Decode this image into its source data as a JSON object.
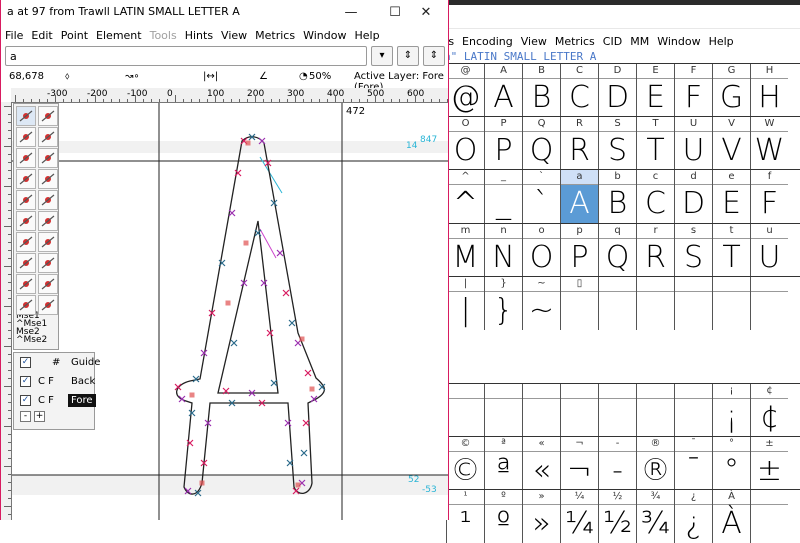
{
  "font_window": {
    "menu": [
      "ts",
      "Encoding",
      "View",
      "Metrics",
      "CID",
      "MM",
      "Window",
      "Help"
    ],
    "glyph_name": "a\" LATIN SMALL LETTER A",
    "rows": [
      {
        "labels": [
          "@",
          "A",
          "B",
          "C",
          "D",
          "E",
          "F",
          "G",
          "H"
        ],
        "glyphs": [
          "@",
          "A",
          "B",
          "C",
          "D",
          "E",
          "F",
          "G",
          "H"
        ]
      },
      {
        "labels": [
          "O",
          "P",
          "Q",
          "R",
          "S",
          "T",
          "U",
          "V",
          "W"
        ],
        "glyphs": [
          "O",
          "P",
          "Q",
          "R",
          "S",
          "T",
          "U",
          "V",
          "W"
        ]
      },
      {
        "labels": [
          "^",
          "_",
          "`",
          "a",
          "b",
          "c",
          "d",
          "e",
          "f"
        ],
        "glyphs": [
          "^",
          "_",
          "`",
          "A",
          "B",
          "C",
          "D",
          "E",
          "F"
        ]
      },
      {
        "labels": [
          "m",
          "n",
          "o",
          "p",
          "q",
          "r",
          "s",
          "t",
          "u"
        ],
        "glyphs": [
          "M",
          "N",
          "O",
          "P",
          "Q",
          "R",
          "S",
          "T",
          "U"
        ]
      },
      {
        "labels": [
          "|",
          "}",
          "~",
          "▯",
          "",
          "",
          "",
          "",
          ""
        ],
        "glyphs": [
          "|",
          "}",
          "~",
          "",
          "",
          "",
          "",
          "",
          ""
        ]
      },
      {
        "labels": [
          "",
          "",
          "",
          "",
          "",
          "",
          "",
          "¡",
          "¢"
        ],
        "glyphs": [
          "",
          "",
          "",
          "",
          "",
          "",
          "",
          "¡",
          "¢"
        ]
      },
      {
        "labels": [
          "©",
          "ª",
          "«",
          "¬",
          "-",
          "®",
          "¯",
          "°",
          "±"
        ],
        "glyphs": [
          "©",
          "ª",
          "«",
          "¬",
          "-",
          "®",
          "¯",
          "°",
          "±"
        ]
      },
      {
        "labels": [
          "¹",
          "º",
          "»",
          "¼",
          "½",
          "¾",
          "¿",
          "À",
          ""
        ],
        "glyphs": [
          "¹",
          "º",
          "»",
          "¼",
          "½",
          "¾",
          "¿",
          "À",
          ""
        ]
      }
    ],
    "selected_label": "a"
  },
  "glyph_window": {
    "title": "a at 97 from Trawll LATIN SMALL LETTER A",
    "window_buttons": {
      "minimize": "—",
      "maximize": "☐",
      "close": "✕"
    },
    "menu": [
      "File",
      "Edit",
      "Point",
      "Element",
      "Tools",
      "Hints",
      "View",
      "Metrics",
      "Window",
      "Help"
    ],
    "disabled_menu": "Tools",
    "input_value": "a",
    "buttons": {
      "dropdown": "▾",
      "prev": "⇕",
      "next": "⇕"
    },
    "status": {
      "coords": "68,678",
      "point_symbol": "⬨",
      "zoom": "50%",
      "active_layer": "Active Layer: Fore (Fore)"
    },
    "ruler_labels": [
      "-300",
      "-200",
      "-100",
      "0",
      "100",
      "200",
      "300",
      "400",
      "500",
      "600"
    ],
    "canvas_labels": {
      "advance": "472",
      "ascent": "847",
      "ascent_small": "14",
      "baseline_a": "52",
      "baseline_b": "-53"
    },
    "mouse_labels": [
      "Mse1",
      "^Mse1",
      "Mse2",
      "^Mse2"
    ],
    "layers": [
      {
        "flags": "#",
        "name": "Guide"
      },
      {
        "flags": "C  F",
        "name": "Back"
      },
      {
        "flags": "C  F",
        "name": "Fore"
      }
    ],
    "layer_buttons": {
      "remove": "-",
      "add": "+"
    }
  },
  "colors": {
    "accent_magenta": "#d81b60",
    "selection_blue": "#5b9bd5",
    "guide_cyan": "#2ab5d6",
    "outline": "#222222"
  }
}
